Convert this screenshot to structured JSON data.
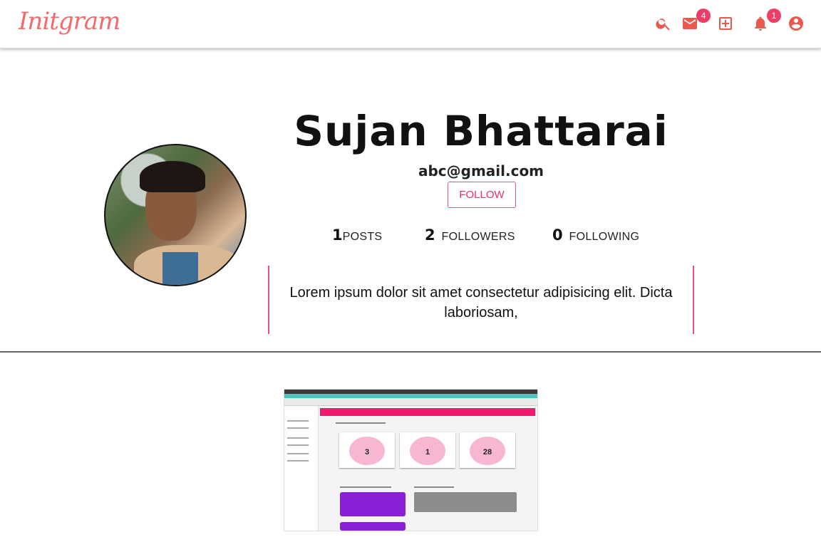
{
  "header": {
    "logo": "Initgram",
    "icons": [
      "search-icon",
      "mail-icon",
      "add-box-icon",
      "bell-icon",
      "account-circle-icon"
    ],
    "mail_badge": "4",
    "notification_badge": "1",
    "accent_color": "#e85a4f",
    "badge_color": "#ee3d66"
  },
  "profile": {
    "name": "Sujan Bhattarai",
    "email": "abc@gmail.com",
    "follow_label": "FOLLOW",
    "stats": {
      "posts_count": "1",
      "posts_label": "POSTS",
      "followers_count": "2",
      "followers_label": "FOLLOWERS",
      "following_count": "0",
      "following_label": "FOLLOWING"
    },
    "bio": "Lorem ipsum dolor sit amet consectetur adipisicing elit. Dicta laboriosam,",
    "accent_color": "#ee4f88"
  },
  "posts": {
    "thumbnail": {
      "card_numbers": [
        "3",
        "1",
        "28"
      ]
    }
  }
}
